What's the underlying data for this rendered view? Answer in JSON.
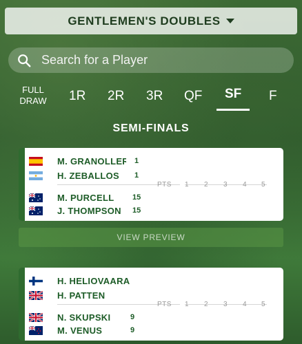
{
  "event_selector": {
    "label": "GENTLEMEN'S DOUBLES"
  },
  "search": {
    "placeholder": "Search for a Player"
  },
  "rounds": [
    {
      "label_line1": "FULL",
      "label_line2": "DRAW"
    },
    {
      "label": "1R"
    },
    {
      "label": "2R"
    },
    {
      "label": "3R"
    },
    {
      "label": "QF"
    },
    {
      "label": "SF",
      "active": true
    },
    {
      "label": "F"
    }
  ],
  "stage_title": "SEMI-FINALS",
  "score_header": {
    "pts": "PTS",
    "sets": [
      "1",
      "2",
      "3",
      "4",
      "5"
    ]
  },
  "matches": [
    {
      "team1": {
        "players": [
          {
            "name": "M. GRANOLLERS",
            "flag": "spain",
            "seed": "1"
          },
          {
            "name": "H. ZEBALLOS",
            "flag": "argentina",
            "seed": "1"
          }
        ]
      },
      "team2": {
        "players": [
          {
            "name": "M. PURCELL",
            "flag": "australia",
            "seed": "15"
          },
          {
            "name": "J. THOMPSON",
            "flag": "australia",
            "seed": "15"
          }
        ]
      }
    },
    {
      "team1": {
        "players": [
          {
            "name": "H. HELIOVAARA",
            "flag": "finland",
            "seed": ""
          },
          {
            "name": "H. PATTEN",
            "flag": "great-britain",
            "seed": ""
          }
        ]
      },
      "team2": {
        "players": [
          {
            "name": "N. SKUPSKI",
            "flag": "great-britain",
            "seed": "9"
          },
          {
            "name": "M. VENUS",
            "flag": "new-zealand",
            "seed": "9"
          }
        ]
      }
    }
  ],
  "view_preview": "VIEW PREVIEW",
  "colors": {
    "brand_green": "#1d5c27",
    "accent": "#2f6b2f"
  }
}
